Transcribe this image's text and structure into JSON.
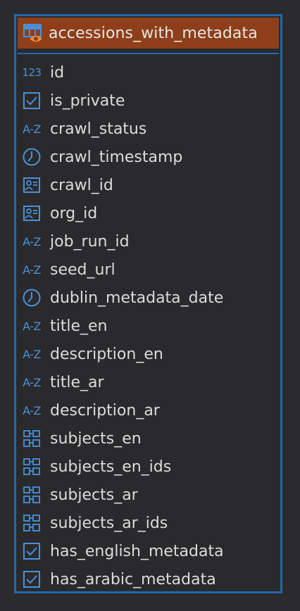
{
  "table": {
    "title": "accessions_with_metadata",
    "header_color": "#8e3f1a",
    "border_color": "#1f68b0",
    "icon_color": "#4a90d9",
    "columns": [
      {
        "name": "id",
        "type_icon": "numeric-icon",
        "icon_text": "123"
      },
      {
        "name": "is_private",
        "type_icon": "checkbox-icon"
      },
      {
        "name": "crawl_status",
        "type_icon": "text-az-icon",
        "icon_text": "A-Z"
      },
      {
        "name": "crawl_timestamp",
        "type_icon": "clock-icon"
      },
      {
        "name": "crawl_id",
        "type_icon": "id-card-icon"
      },
      {
        "name": "org_id",
        "type_icon": "id-card-icon"
      },
      {
        "name": "job_run_id",
        "type_icon": "text-az-icon",
        "icon_text": "A-Z"
      },
      {
        "name": "seed_url",
        "type_icon": "text-az-icon",
        "icon_text": "A-Z"
      },
      {
        "name": "dublin_metadata_date",
        "type_icon": "clock-icon"
      },
      {
        "name": "title_en",
        "type_icon": "text-az-icon",
        "icon_text": "A-Z"
      },
      {
        "name": "description_en",
        "type_icon": "text-az-icon",
        "icon_text": "A-Z"
      },
      {
        "name": "title_ar",
        "type_icon": "text-az-icon",
        "icon_text": "A-Z"
      },
      {
        "name": "description_ar",
        "type_icon": "text-az-icon",
        "icon_text": "A-Z"
      },
      {
        "name": "subjects_en",
        "type_icon": "array-icon"
      },
      {
        "name": "subjects_en_ids",
        "type_icon": "array-icon"
      },
      {
        "name": "subjects_ar",
        "type_icon": "array-icon"
      },
      {
        "name": "subjects_ar_ids",
        "type_icon": "array-icon"
      },
      {
        "name": "has_english_metadata",
        "type_icon": "checkbox-icon"
      },
      {
        "name": "has_arabic_metadata",
        "type_icon": "checkbox-icon"
      }
    ]
  }
}
